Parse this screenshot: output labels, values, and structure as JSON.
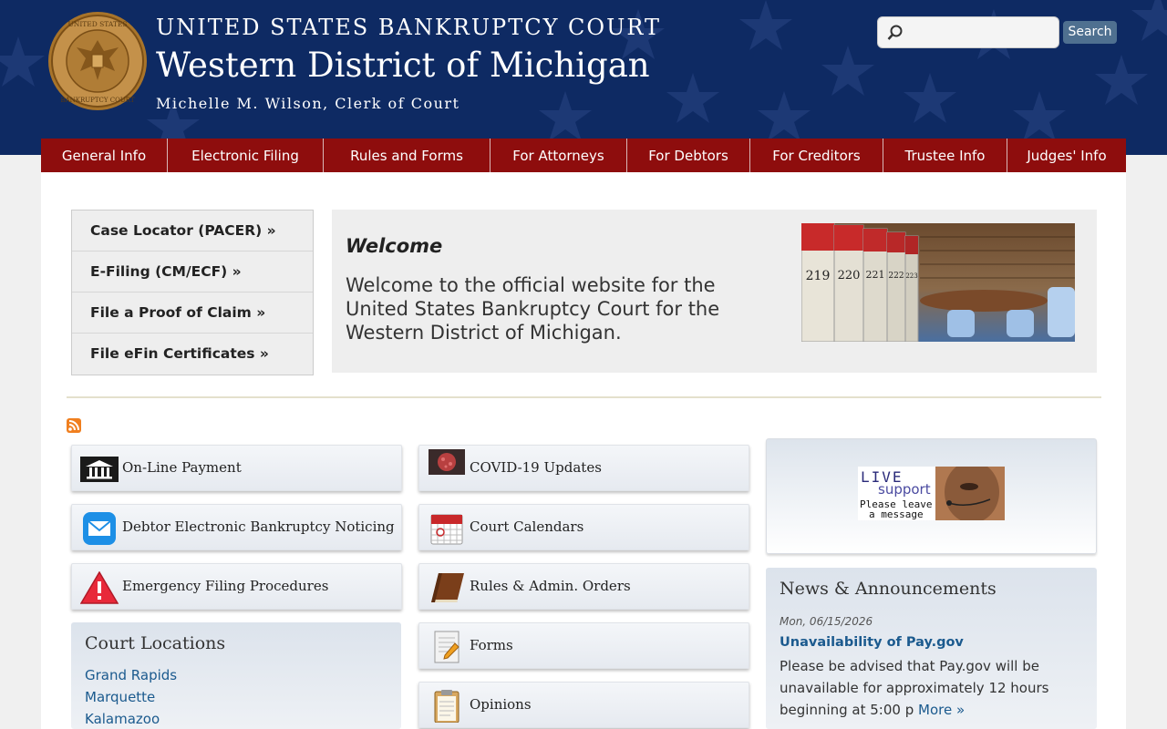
{
  "header": {
    "court_name": "UNITED STATES BANKRUPTCY COURT",
    "district": "Western District of Michigan",
    "clerk": "Michelle M. Wilson, Clerk of Court",
    "seal_text_top": "UNITED STATES",
    "seal_text_bottom": "BANKRUPTCY COURT"
  },
  "search": {
    "placeholder": "",
    "button_label": "Search"
  },
  "nav": [
    "General Info",
    "Electronic Filing",
    "Rules and Forms",
    "For Attorneys",
    "For Debtors",
    "For Creditors",
    "Trustee Info",
    "Judges' Info"
  ],
  "quick_links": [
    "Case Locator (PACER) »",
    "E-Filing (CM/ECF) »",
    "File a Proof of Claim »",
    "File eFin Certificates »"
  ],
  "welcome": {
    "title": "Welcome",
    "text": "Welcome to the official website for the United States Bankruptcy Court for the Western District of Michigan.",
    "photo_book_numbers": [
      "219",
      "220",
      "221",
      "222",
      "223"
    ]
  },
  "tiles_left": [
    {
      "label": "On-Line Payment",
      "icon": "bank-icon"
    },
    {
      "label": "Debtor Electronic Bankruptcy Noticing",
      "icon": "mail-icon"
    },
    {
      "label": "Emergency Filing Procedures",
      "icon": "warning-icon"
    }
  ],
  "tiles_middle": [
    {
      "label": "COVID-19 Updates",
      "icon": "virus-icon"
    },
    {
      "label": "Court Calendars",
      "icon": "calendar-icon"
    },
    {
      "label": "Rules & Admin. Orders",
      "icon": "book-icon"
    },
    {
      "label": "Forms",
      "icon": "form-icon"
    },
    {
      "label": "Opinions",
      "icon": "clipboard-icon"
    }
  ],
  "locations": {
    "title": "Court Locations",
    "items": [
      "Grand Rapids",
      "Marquette",
      "Kalamazoo"
    ]
  },
  "live_support": {
    "line1": "LIVE",
    "line2": "support",
    "line3": "Please leave",
    "line4": "a message"
  },
  "news": {
    "title": "News & Announcements",
    "date": "Mon, 06/15/2026",
    "headline": "Unavailability of Pay.gov",
    "body": "Please be advised that Pay.gov will be unavailable for approximately 12 hours beginning at 5:00 p",
    "more": "More »"
  },
  "colors": {
    "header_bg": "#0e2a63",
    "nav_bg": "#8e0d0d",
    "link": "#1b5a8e"
  }
}
